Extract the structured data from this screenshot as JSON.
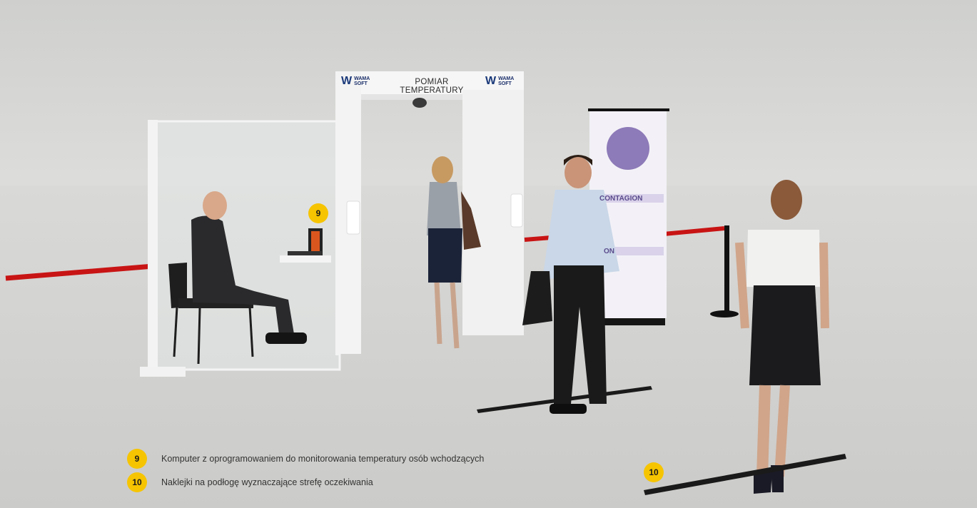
{
  "gate": {
    "title": "POMIAR TEMPERATURY",
    "logo_left": {
      "line1": "WAMA",
      "line2": "SOFT"
    },
    "logo_right": {
      "line1": "WAMA",
      "line2": "SOFT"
    }
  },
  "banner": {
    "heading_1": "CONTAGION",
    "heading_2": "ON"
  },
  "markers": {
    "marker_9": "9",
    "marker_10": "10"
  },
  "legend": [
    {
      "number": "9",
      "text": "Komputer z oprogramowaniem do monitorowania temperatury osób wchodzących"
    },
    {
      "number": "10",
      "text": "Naklejki na podłogę wyznaczające strefę oczekiwania"
    }
  ],
  "colors": {
    "badge": "#f6c400",
    "rope": "#c81414",
    "logo": "#1b3a7a"
  }
}
